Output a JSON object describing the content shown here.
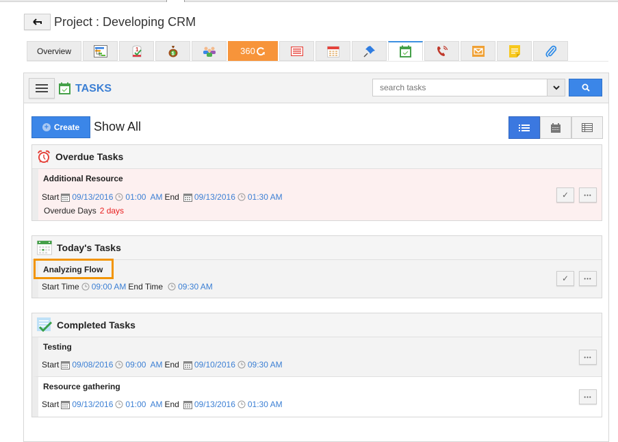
{
  "header": {
    "back_label": "back",
    "project_title": "Project : Developing CRM"
  },
  "tabs": [
    {
      "label": "Overview",
      "icon": "overview"
    },
    {
      "label": "",
      "icon": "gantt-chart-icon"
    },
    {
      "label": "",
      "icon": "milestone-icon"
    },
    {
      "label": "",
      "icon": "money-bag-icon"
    },
    {
      "label": "",
      "icon": "team-icon"
    },
    {
      "label": "360",
      "icon": "refresh-360-icon"
    },
    {
      "label": "",
      "icon": "notes-icon"
    },
    {
      "label": "",
      "icon": "calendar-icon"
    },
    {
      "label": "",
      "icon": "pin-icon"
    },
    {
      "label": "",
      "icon": "tasks-icon",
      "active": true
    },
    {
      "label": "",
      "icon": "phone-icon"
    },
    {
      "label": "",
      "icon": "mail-icon"
    },
    {
      "label": "",
      "icon": "sticky-note-icon"
    },
    {
      "label": "",
      "icon": "paperclip-icon"
    }
  ],
  "panel": {
    "title": "TASKS",
    "search_placeholder": "search tasks",
    "create_label": "Create",
    "show_all_label": "Show All",
    "views": [
      "list-view",
      "calendar-view",
      "table-view"
    ],
    "active_view": "list-view"
  },
  "sections": {
    "overdue": {
      "title": "Overdue Tasks",
      "tasks": [
        {
          "name": "Additional Resource",
          "start_label": "Start",
          "start_date": "09/13/2016",
          "start_time": "01:00  AM",
          "end_label": "End",
          "end_date": "09/13/2016",
          "end_time": "01:30 AM",
          "overdue_label": "Overdue Days",
          "overdue_value": "2 days"
        }
      ]
    },
    "today": {
      "title": "Today's Tasks",
      "tasks": [
        {
          "name": "Analyzing Flow",
          "start_label": "Start Time",
          "start_time": "09:00 AM",
          "end_label": "End Time",
          "end_time": "09:30 AM"
        }
      ]
    },
    "completed": {
      "title": "Completed Tasks",
      "tasks": [
        {
          "name": "Testing",
          "start_label": "Start",
          "start_date": "09/08/2016",
          "start_time": "09:00  AM",
          "end_label": "End",
          "end_date": "09/10/2016",
          "end_time": "09:30 AM"
        },
        {
          "name": "Resource gathering",
          "start_label": "Start",
          "start_date": "09/13/2016",
          "start_time": "01:00  AM",
          "end_label": "End",
          "end_date": "09/13/2016",
          "end_time": "01:30 AM"
        }
      ]
    }
  },
  "actions": {
    "complete_glyph": "✓",
    "more_glyph": "•••"
  },
  "colors": {
    "accent_blue": "#3b86e8",
    "title_blue": "#3b7fd4",
    "orange_tab": "#f7943a",
    "highlight": "#f29400",
    "overdue_bg": "#fdf0f0",
    "overdue_red": "#e81e1e"
  }
}
